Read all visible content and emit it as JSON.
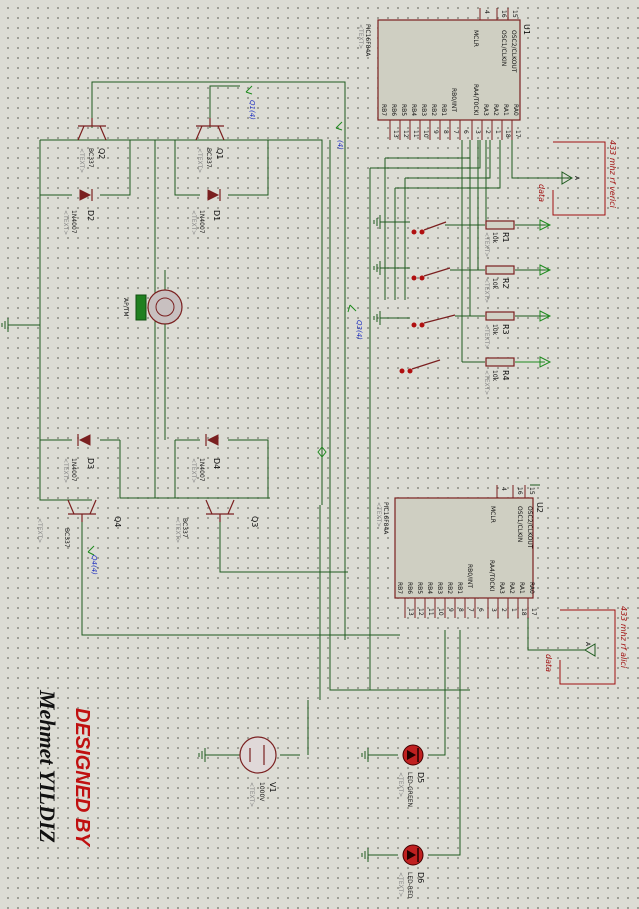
{
  "ics": [
    {
      "ref": "U1",
      "part": "PIC16F84A",
      "left_pins": [
        "MCLR",
        "OSC1/CLKIN",
        "OSC2/CLKOUT"
      ],
      "right_pins": [
        "RA0",
        "RA1",
        "RA2",
        "RA3",
        "RA4/T0CKI",
        "RB0/INT",
        "RB1",
        "RB2",
        "RB3",
        "RB4",
        "RB5",
        "RB6",
        "RB7"
      ],
      "pin_nums": [
        "4",
        "16",
        "15",
        "17",
        "18",
        "1",
        "2",
        "3",
        "6",
        "7",
        "8",
        "9",
        "10",
        "11",
        "12",
        "13"
      ]
    },
    {
      "ref": "U2",
      "part": "PIC16F84A",
      "left_pins": [
        "MCLR",
        "OSC1/CLKIN",
        "OSC2/CLKOUT"
      ],
      "right_pins": [
        "RA0",
        "RA1",
        "RA2",
        "RA3",
        "RA4/T0CKI",
        "RB0/INT",
        "RB1",
        "RB2",
        "RB3",
        "RB4",
        "RB5",
        "RB6",
        "RB7"
      ],
      "pin_nums": [
        "4",
        "16",
        "15",
        "17",
        "18",
        "1",
        "2",
        "3",
        "6",
        "7",
        "8",
        "9",
        "10",
        "11",
        "12",
        "13"
      ]
    }
  ],
  "transistors": [
    {
      "ref": "Q1",
      "part": "BC337"
    },
    {
      "ref": "Q2",
      "part": "BC337"
    },
    {
      "ref": "Q3",
      "part": "BC337"
    },
    {
      "ref": "Q4",
      "part": "BC337"
    }
  ],
  "diodes": [
    {
      "ref": "D1",
      "part": "1N4007"
    },
    {
      "ref": "D2",
      "part": "1N4007"
    },
    {
      "ref": "D3",
      "part": "1N4007"
    },
    {
      "ref": "D4",
      "part": "1N4007"
    }
  ],
  "resistors": [
    {
      "ref": "R1",
      "value": "10k"
    },
    {
      "ref": "R2",
      "value": "10k"
    },
    {
      "ref": "R3",
      "value": "10k"
    },
    {
      "ref": "R4",
      "value": "10k"
    }
  ],
  "leds": [
    {
      "ref": "D5",
      "part": "LED-GREEN"
    },
    {
      "ref": "D6",
      "part": "LED-RED"
    }
  ],
  "battery": {
    "ref": "V1",
    "value": "1000V"
  },
  "motor": {
    "ref": "M1",
    "label": "AP/TM"
  },
  "placeholder": "<TEXT>",
  "net_labels": {
    "q1": "Q1(4)",
    "q2": "Q2(4)",
    "q3": "Q3(4)",
    "q4": "Q4(4)",
    "net4": "(4)"
  },
  "rf": {
    "verici": "433 mhz rf verici",
    "alici": "433 mhz rf alici",
    "data": "data",
    "pin": "A"
  },
  "credit": {
    "designed": "DESIGNED BY",
    "name": "Mehmet YILDIZ"
  },
  "colors": {
    "wire": "#1e5a1e",
    "component": "#7a2020",
    "label_blue": "#2030c0",
    "label_red": "#a01010",
    "led": "#c02020",
    "motor_green": "#208020",
    "background": "#dcdcd4"
  }
}
